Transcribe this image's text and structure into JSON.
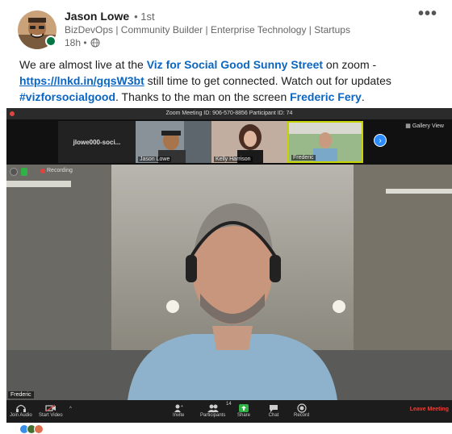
{
  "author": {
    "name": "Jason Lowe",
    "degree": "• 1st",
    "headline": "BizDevOps | Community Builder | Enterprise Technology | Startups",
    "time": "18h •"
  },
  "post": {
    "t1": "We are almost live at the ",
    "mention1": "Viz for Social Good",
    "t2": " ",
    "mention2": "Sunny Street",
    "t3": " on zoom - ",
    "link": "https://lnkd.in/gqsW3bt",
    "t4": " still time to get connected. Watch out for updates ",
    "hashtag": "#vizforsocialgood",
    "t5": ". Thanks to the man on the screen ",
    "mention3": "Frederic Fery",
    "t6": "."
  },
  "zoom": {
    "title": "Zoom Meeting ID: 906-570-8856 Participant ID: 74",
    "gallery_label": "Gallery View",
    "tiles": [
      {
        "label": "jlowe000-soci..."
      },
      {
        "label": "Jason Lowe"
      },
      {
        "label": "Kelly Harrison"
      },
      {
        "label": "Frederic"
      }
    ],
    "recording_label": "Recording",
    "speaker_label": "Frederic",
    "participants_count": "14",
    "toolbar": {
      "join_audio": "Join Audio",
      "start_video": "Start Video",
      "invite": "Invite",
      "participants": "Participants",
      "share": "Share",
      "chat": "Chat",
      "record": "Record",
      "leave": "Leave Meeting"
    }
  },
  "colors": {
    "link": "#0a66c2",
    "online": "#057642",
    "zoom_blue": "#2d8cff",
    "leave_red": "#e0443e"
  }
}
